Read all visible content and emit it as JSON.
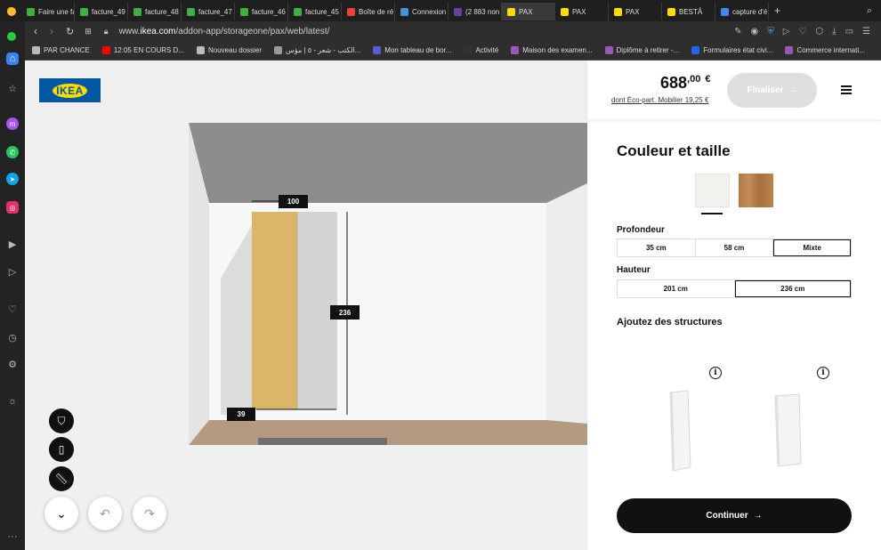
{
  "browser": {
    "tabs": [
      {
        "label": "Faire une fa",
        "favicon_color": "#3cb043"
      },
      {
        "label": "facture_49",
        "favicon_color": "#3cb043"
      },
      {
        "label": "facture_48",
        "favicon_color": "#3cb043"
      },
      {
        "label": "facture_47",
        "favicon_color": "#3cb043"
      },
      {
        "label": "facture_46",
        "favicon_color": "#3cb043"
      },
      {
        "label": "facture_45",
        "favicon_color": "#3cb043"
      },
      {
        "label": "Boîte de ré",
        "favicon_color": "#ea4335"
      },
      {
        "label": "Connexion",
        "favicon_color": "#4a90d9"
      },
      {
        "label": "(2 883 non",
        "favicon_color": "#6b3fa0"
      },
      {
        "label": "PAX",
        "favicon_color": "#ffdb00",
        "active": true
      },
      {
        "label": "PAX",
        "favicon_color": "#ffdb00"
      },
      {
        "label": "PAX",
        "favicon_color": "#ffdb00"
      },
      {
        "label": "BESTÅ",
        "favicon_color": "#ffdb00"
      },
      {
        "label": "capture d'é",
        "favicon_color": "#4285f4"
      }
    ],
    "url_prefix": "www.",
    "url_domain": "ikea.com",
    "url_path": "/addon-app/storageone/pax/web/latest/",
    "bookmarks": [
      {
        "label": "PAR CHANCE",
        "icon": "folder-icon"
      },
      {
        "label": "12:05 EN COURS D...",
        "icon": "youtube-icon"
      },
      {
        "label": "Nouveau dossier",
        "icon": "folder-icon"
      },
      {
        "label": "الكتب - شعر - ٥ | مؤس...",
        "icon": "book-icon"
      },
      {
        "label": "Mon tableau de bor...",
        "icon": "dashboard-icon"
      },
      {
        "label": "Activité",
        "icon": "activity-icon"
      },
      {
        "label": "Maison des examen...",
        "icon": "link-icon"
      },
      {
        "label": "Diplôme à retirer -...",
        "icon": "link-icon"
      },
      {
        "label": "Formulaires état civi...",
        "icon": "flag-icon"
      },
      {
        "label": "Commerce internati...",
        "icon": "link-icon"
      }
    ]
  },
  "canvas": {
    "logo_text": "IKEA",
    "dimensions": {
      "width": "100",
      "height": "236",
      "depth": "39"
    },
    "door_color": "#dcb46a"
  },
  "panel": {
    "price_main": "688",
    "price_cents": ",00",
    "currency": "€",
    "eco_text": "dont Éco-part. Mobilier 19,25 €",
    "finaliser_label": "Finaliser",
    "section_title": "Couleur et taille",
    "swatches": [
      {
        "name": "white",
        "color": "#f2f1ee",
        "selected": true
      },
      {
        "name": "oak",
        "color": "#b07a49",
        "selected": false
      }
    ],
    "profondeur_label": "Profondeur",
    "profondeur_options": [
      "35 cm",
      "58 cm",
      "Mixte"
    ],
    "profondeur_selected": "Mixte",
    "hauteur_label": "Hauteur",
    "hauteur_options": [
      "201 cm",
      "236 cm"
    ],
    "hauteur_selected": "236 cm",
    "structures_title": "Ajoutez des structures",
    "info_glyph": "i",
    "continuer_label": "Continuer"
  }
}
